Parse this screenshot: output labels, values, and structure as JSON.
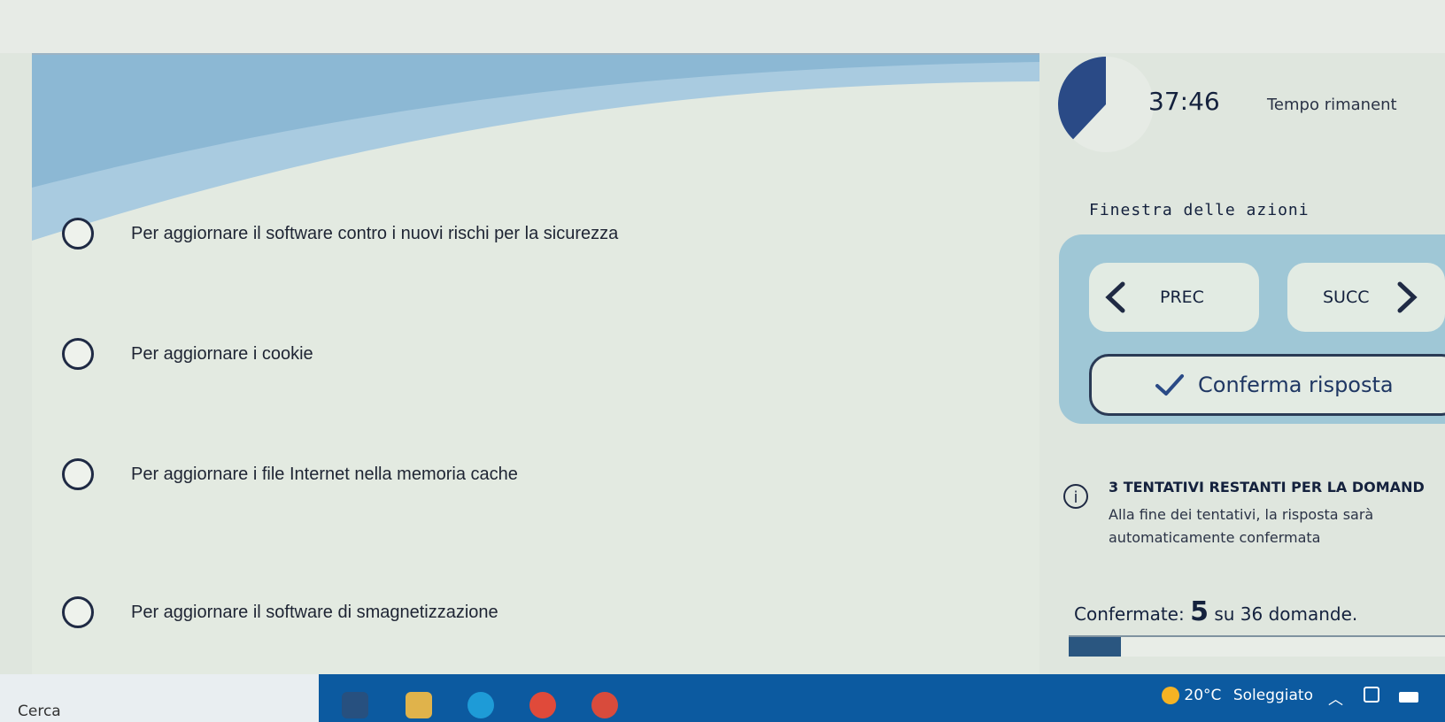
{
  "timer": {
    "time": "37:46",
    "label": "Tempo rimanent",
    "remaining_fraction": 0.38
  },
  "options": [
    {
      "label": "Per aggiornare il software contro i nuovi rischi per la sicurezza"
    },
    {
      "label": "Per aggiornare i cookie"
    },
    {
      "label": "Per aggiornare i file Internet nella memoria cache"
    },
    {
      "label": "Per aggiornare il software di smagnetizzazione"
    }
  ],
  "actions": {
    "title": "Finestra delle azioni",
    "prev_label": "PREC",
    "next_label": "SUCC",
    "confirm_label": "Conferma risposta"
  },
  "attempts": {
    "title": "3 TENTATIVI RESTANTI PER LA DOMAND",
    "text": "Alla fine dei tentativi, la risposta sarà automaticamente confermata"
  },
  "progress": {
    "prefix": "Confermate:",
    "count": "5",
    "suffix": "su 36 domande.",
    "fraction": 0.139
  },
  "taskbar": {
    "search": "Cerca",
    "temperature": "20°C",
    "weather": "Soleggiato",
    "icons": [
      "task-view-icon",
      "file-explorer-icon",
      "edge-icon",
      "chrome-icon",
      "chrome-profile-icon"
    ]
  },
  "colors": {
    "accent": "#2a4a86",
    "panel": "#9fc7d6",
    "progress": "#2a5680"
  }
}
